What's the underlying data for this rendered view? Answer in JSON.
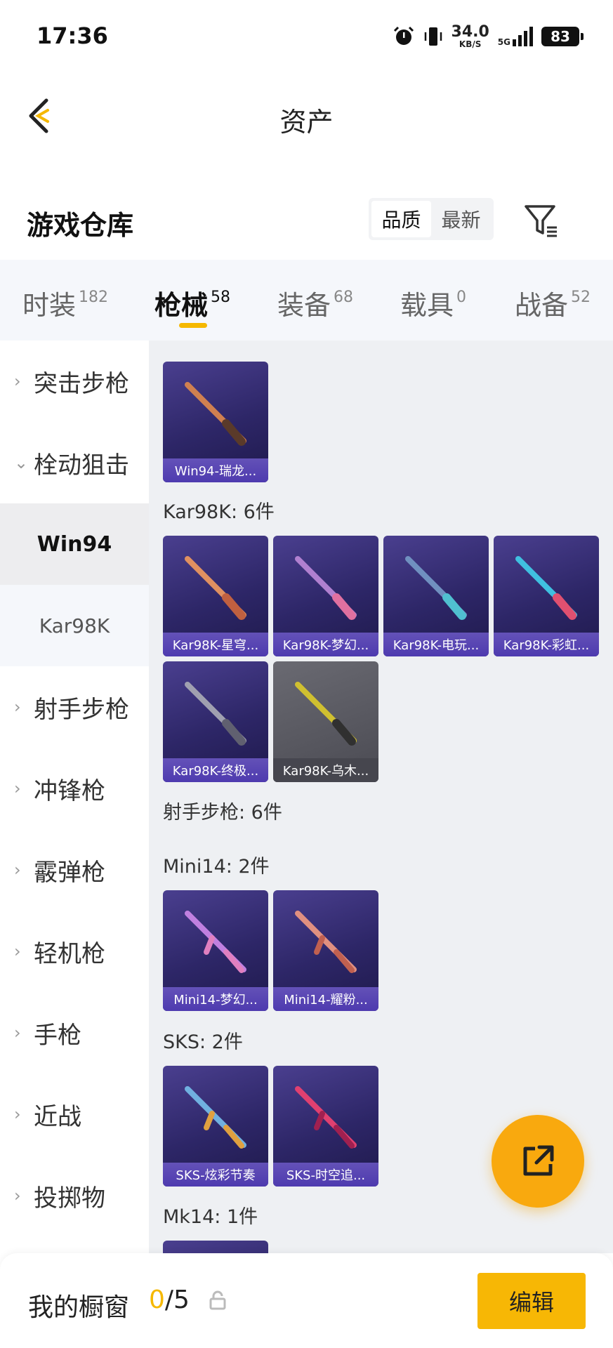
{
  "status": {
    "time": "17:36",
    "net_speed": "34.0",
    "net_unit": "KB/S",
    "network": "5G",
    "battery": "83"
  },
  "nav": {
    "title": "资产"
  },
  "section": {
    "title": "游戏仓库",
    "sort_options": [
      "品质",
      "最新"
    ],
    "selected_sort": "品质"
  },
  "tabs": [
    {
      "label": "时装",
      "count": "182"
    },
    {
      "label": "枪械",
      "count": "58"
    },
    {
      "label": "装备",
      "count": "68"
    },
    {
      "label": "载具",
      "count": "0"
    },
    {
      "label": "战备",
      "count": "52"
    }
  ],
  "active_tab": "枪械",
  "sidebar": {
    "items": [
      {
        "label": "突击步枪"
      },
      {
        "label": "栓动狙击"
      },
      {
        "label": "Win94"
      },
      {
        "label": "Kar98K"
      },
      {
        "label": "射手步枪"
      },
      {
        "label": "冲锋枪"
      },
      {
        "label": "霰弹枪"
      },
      {
        "label": "轻机枪"
      },
      {
        "label": "手枪"
      },
      {
        "label": "近战"
      },
      {
        "label": "投掷物"
      }
    ]
  },
  "content": {
    "groups": [
      {
        "label": "Kar98K: 6件"
      },
      {
        "label": "射手步枪: 6件"
      },
      {
        "label": "Mini14: 2件"
      },
      {
        "label": "SKS: 2件"
      },
      {
        "label": "Mk14: 1件"
      }
    ],
    "cards": [
      {
        "label": "Win94-瑞龙...",
        "tint": "#d08050"
      },
      {
        "label": "Kar98K-星穹...",
        "tint": "#e09060"
      },
      {
        "label": "Kar98K-梦幻...",
        "tint": "#b080d0"
      },
      {
        "label": "Kar98K-电玩...",
        "tint": "#7090c0"
      },
      {
        "label": "Kar98K-彩虹...",
        "tint": "#e05070"
      },
      {
        "label": "Kar98K-终极...",
        "tint": "#a0a0b0"
      },
      {
        "label": "Kar98K-乌木...",
        "tint": "#d0c030"
      },
      {
        "label": "Mini14-梦幻...",
        "tint": "#c080e0"
      },
      {
        "label": "Mini14-耀粉...",
        "tint": "#e09080"
      },
      {
        "label": "SKS-炫彩节奏",
        "tint": "#70b0e0"
      },
      {
        "label": "SKS-时空追...",
        "tint": "#e04070"
      }
    ]
  },
  "bottom": {
    "title": "我的橱窗",
    "count_current": "0",
    "count_total": "/5",
    "edit_label": "编辑"
  }
}
